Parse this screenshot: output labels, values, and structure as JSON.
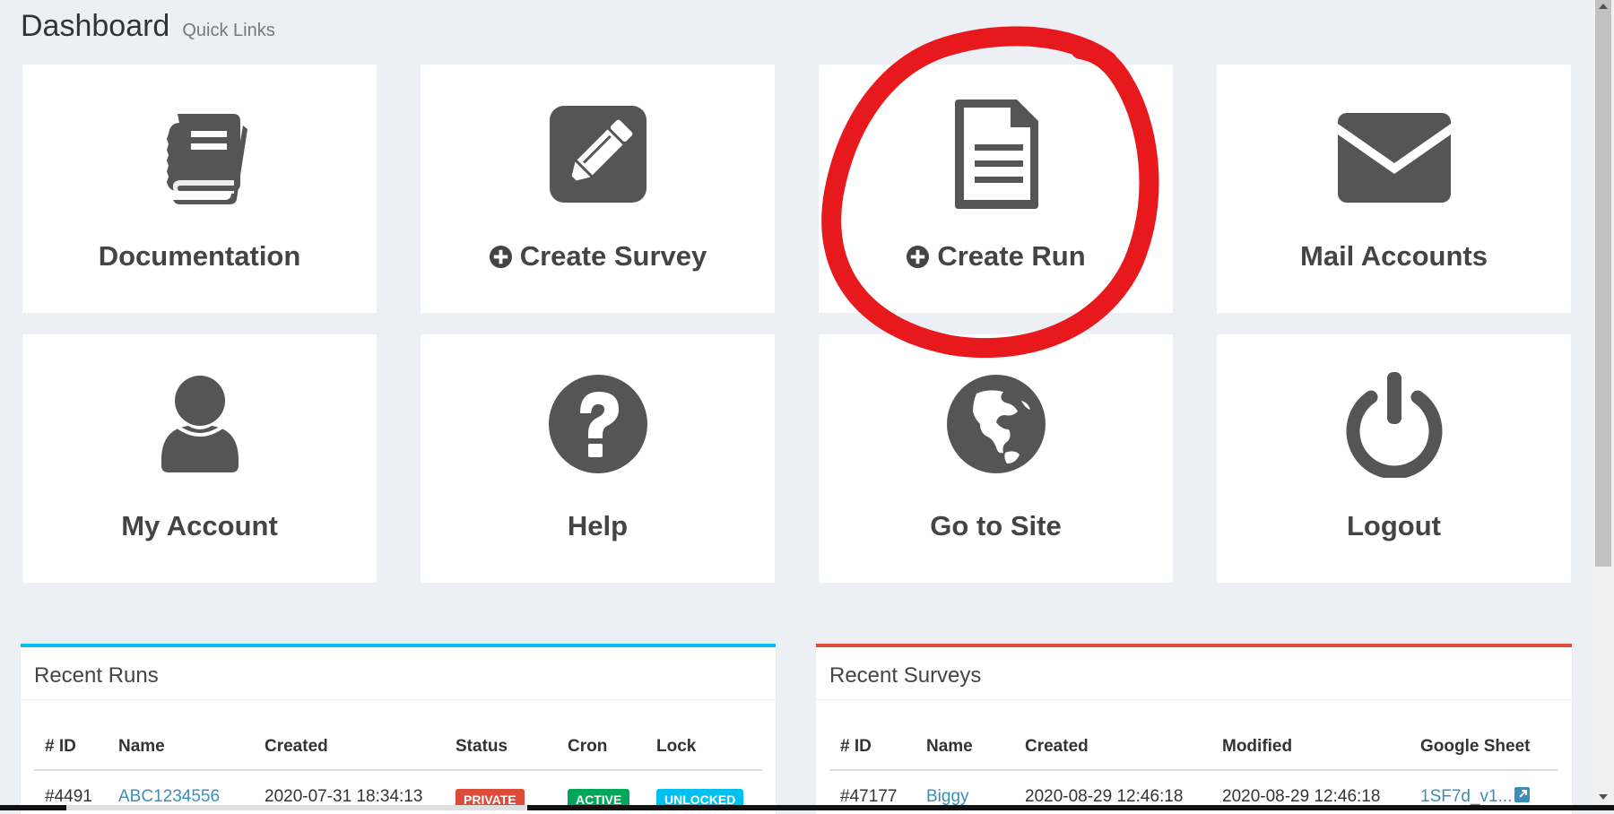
{
  "header": {
    "title": "Dashboard",
    "subtitle": "Quick Links"
  },
  "tiles": [
    {
      "label": "Documentation",
      "icon": "book-icon"
    },
    {
      "label": "Create Survey",
      "icon": "pencil-square-icon",
      "prefix_icon": "plus-circle-icon"
    },
    {
      "label": "Create Run",
      "icon": "file-text-icon",
      "prefix_icon": "plus-circle-icon"
    },
    {
      "label": "Mail Accounts",
      "icon": "envelope-icon"
    },
    {
      "label": "My Account",
      "icon": "user-icon"
    },
    {
      "label": "Help",
      "icon": "question-circle-icon"
    },
    {
      "label": "Go to Site",
      "icon": "globe-icon"
    },
    {
      "label": "Logout",
      "icon": "power-icon"
    }
  ],
  "recent_runs": {
    "title": "Recent Runs",
    "accent": "#00c0ef",
    "columns": [
      "# ID",
      "Name",
      "Created",
      "Status",
      "Cron",
      "Lock"
    ],
    "rows": [
      {
        "id": "#4491",
        "name": "ABC1234556",
        "created": "2020-07-31 18:34:13",
        "status": "PRIVATE",
        "cron": "ACTIVE",
        "lock": "UNLOCKED"
      }
    ]
  },
  "recent_surveys": {
    "title": "Recent Surveys",
    "accent": "#dd4b39",
    "columns": [
      "# ID",
      "Name",
      "Created",
      "Modified",
      "Google Sheet"
    ],
    "rows": [
      {
        "id": "#47177",
        "name": "Biggy",
        "created": "2020-08-29 12:46:18",
        "modified": "2020-08-29 12:46:18",
        "sheet": "1SF7d_v1..."
      }
    ]
  },
  "colors": {
    "background": "#ecf0f5",
    "icon": "#555555",
    "annotation": "#e8191d",
    "private": "#dd4b39",
    "active": "#00a65a",
    "unlocked": "#00c0ef",
    "link": "#3c8dbc"
  }
}
